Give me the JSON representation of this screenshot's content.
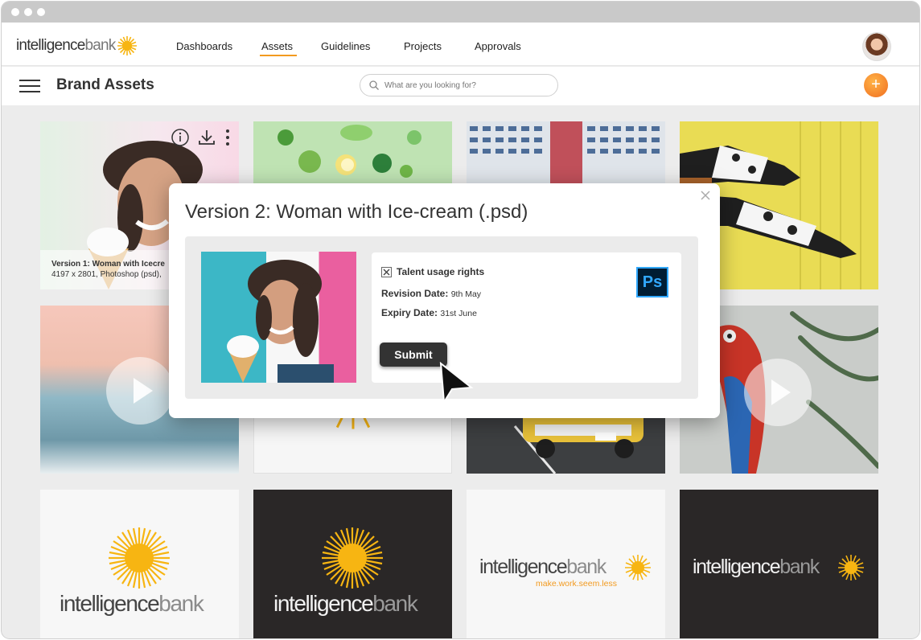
{
  "window": {
    "controls": [
      "close",
      "minimize",
      "maximize"
    ]
  },
  "logo": {
    "part1": "intelligence",
    "part2": "bank",
    "icon": "sun-icon"
  },
  "nav": {
    "items": [
      {
        "label": "Dashboards",
        "active": false
      },
      {
        "label": "Assets",
        "active": true
      },
      {
        "label": "Guidelines",
        "active": false
      },
      {
        "label": "Projects",
        "active": false
      },
      {
        "label": "Approvals",
        "active": false
      }
    ]
  },
  "header": {
    "title": "Brand Assets",
    "menu_icon": "hamburger-icon",
    "add_icon": "plus-icon"
  },
  "search": {
    "placeholder": "What are you looking for?",
    "value": ""
  },
  "tiles": {
    "first_caption_title": "Version 1: Woman with Icecre",
    "first_caption_meta": "4197 x 2801, Photoshop (psd),",
    "tile_icons": [
      "info-icon",
      "download-icon",
      "more-icon"
    ]
  },
  "logos": {
    "word1": "intelligence",
    "word2": "bank",
    "tagline": "make.work.seem.less"
  },
  "dialog": {
    "title": "Version 2: Woman with Ice-cream (.psd)",
    "checkbox_label": "Talent usage rights",
    "checkbox_checked": true,
    "revision_label": "Revision Date:",
    "revision_value": "9th May",
    "expiry_label": "Expiry Date:",
    "expiry_value": "31st June",
    "submit_label": "Submit",
    "file_type_badge": "Ps"
  },
  "colors": {
    "accent": "#f29a1f",
    "sun": "#f7b512",
    "dark_tile": "#2a2727",
    "submit": "#333333"
  }
}
